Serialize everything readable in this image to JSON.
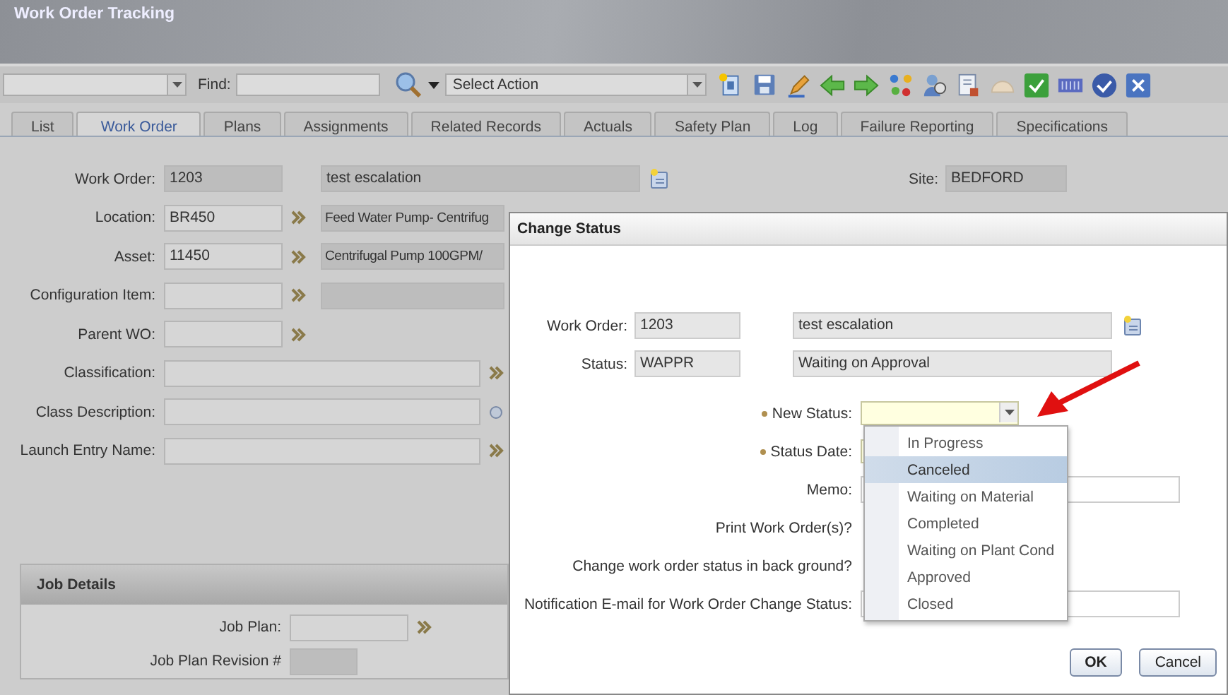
{
  "window": {
    "title": "Work Order Tracking"
  },
  "toolbar": {
    "find_label": "Find:",
    "action_placeholder": "Select Action"
  },
  "tabs": [
    {
      "label": "List",
      "selected": false
    },
    {
      "label": "Work Order",
      "selected": true
    },
    {
      "label": "Plans",
      "selected": false
    },
    {
      "label": "Assignments",
      "selected": false
    },
    {
      "label": "Related Records",
      "selected": false
    },
    {
      "label": "Actuals",
      "selected": false
    },
    {
      "label": "Safety Plan",
      "selected": false
    },
    {
      "label": "Log",
      "selected": false
    },
    {
      "label": "Failure Reporting",
      "selected": false
    },
    {
      "label": "Specifications",
      "selected": false
    }
  ],
  "fields": [
    {
      "kind": "detail",
      "label": "Work Order:",
      "value": "1203",
      "readonly": true,
      "description_field": true,
      "description": "test escalation"
    },
    {
      "kind": "lookup",
      "label": "Location:",
      "value": "BR450",
      "readonly": false,
      "description_field": true,
      "description": "Feed Water Pump- Centrifug"
    },
    {
      "kind": "lookup",
      "label": "Asset:",
      "value": "11450",
      "readonly": false,
      "description_field": true,
      "description": "Centrifugal Pump 100GPM/"
    },
    {
      "kind": "lookup",
      "label": "Configuration Item:",
      "readonly": false,
      "description_field": true
    },
    {
      "kind": "lookup",
      "label": "Parent WO:",
      "readonly": false,
      "description_field": false
    },
    {
      "kind": "wide",
      "label": "Classification:",
      "readonly": false
    },
    {
      "kind": "wide-search",
      "label": "Class Description:",
      "readonly": false
    },
    {
      "kind": "wide",
      "label": "Launch Entry Name:",
      "readonly": false
    }
  ],
  "site": {
    "label": "Site:",
    "value": "BEDFORD"
  },
  "job_details": {
    "title": "Job Details",
    "fields": [
      {
        "kind": "lookup",
        "label": "Job Plan:",
        "readonly": false
      },
      {
        "kind": "plain",
        "label": "Job Plan Revision #",
        "readonly": true
      }
    ]
  },
  "dialog": {
    "title": "Change Status",
    "header_rows": [
      {
        "label": "Work Order:",
        "value": "1203",
        "description": "test escalation"
      },
      {
        "label": "Status:",
        "value": "WAPPR",
        "description": "Waiting on Approval"
      }
    ],
    "form": [
      {
        "kind": "select",
        "label": "New Status:",
        "required": true
      },
      {
        "kind": "date",
        "label": "Status Date:",
        "required": true
      },
      {
        "kind": "text",
        "label": "Memo:",
        "required": false
      },
      {
        "kind": "check",
        "label": "Print Work Order(s)?",
        "required": false
      },
      {
        "kind": "check",
        "label": "Change work order status in back ground?",
        "required": false
      },
      {
        "kind": "text",
        "label": "Notification E-mail for Work Order Change Status:",
        "required": false
      }
    ],
    "options": [
      {
        "label": "In Progress",
        "selected": false
      },
      {
        "label": "Canceled",
        "selected": true
      },
      {
        "label": "Waiting on Material",
        "selected": false
      },
      {
        "label": "Completed",
        "selected": false
      },
      {
        "label": "Waiting on Plant Cond",
        "selected": false
      },
      {
        "label": "Approved",
        "selected": false
      },
      {
        "label": "Closed",
        "selected": false
      }
    ],
    "buttons": [
      {
        "label": "OK",
        "default": true
      },
      {
        "label": "Cancel",
        "default": false
      }
    ]
  }
}
